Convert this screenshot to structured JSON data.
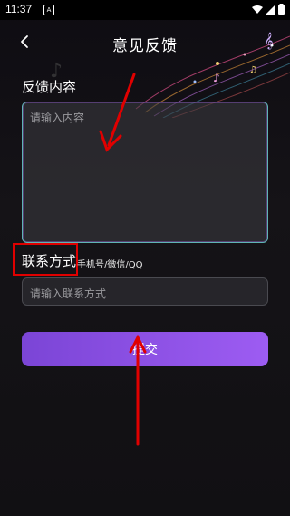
{
  "status_bar": {
    "time": "11:37",
    "notif": "A"
  },
  "header": {
    "title": "意见反馈"
  },
  "form": {
    "content_label": "反馈内容",
    "content_placeholder": "请输入内容",
    "contact_label": "联系方式",
    "contact_hint": "手机号/微信/QQ",
    "contact_placeholder": "请输入联系方式",
    "submit_label": "提交"
  },
  "colors": {
    "accent": "#8b52e8",
    "annotation": "#e00000",
    "border_focus": "#5fb5b5"
  },
  "icons": [
    "back-icon",
    "wifi-icon",
    "signal-icon",
    "battery-icon",
    "music-note-icon"
  ]
}
